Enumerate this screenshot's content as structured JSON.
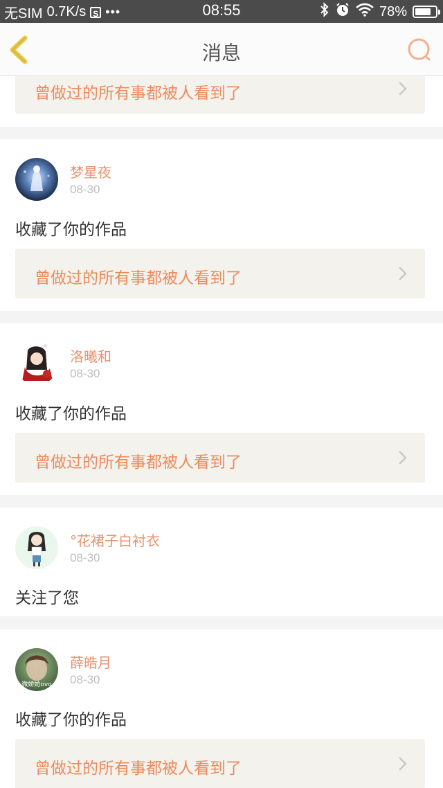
{
  "status_bar": {
    "carrier": "无SIM",
    "speed": "0.7K/s",
    "s_icon_label": "S",
    "more": "•••",
    "time": "08:55",
    "battery_text": "78%",
    "battery_level": 0.78
  },
  "header": {
    "title": "消息",
    "accent_color": "#f3b08c",
    "back_color": "#e8c94a"
  },
  "top_partial": {
    "work_title": "曾做过的所有事都被人看到了"
  },
  "notifications": [
    {
      "username": "梦星夜",
      "date": "08-30",
      "action": "收藏了你的作品",
      "work_title": "曾做过的所有事都被人看到了"
    },
    {
      "username": "洛曦和",
      "date": "08-30",
      "action": "收藏了你的作品",
      "work_title": "曾做过的所有事都被人看到了"
    },
    {
      "username": "°花裙子白衬衣",
      "date": "08-30",
      "action": "关注了您"
    },
    {
      "username": "薛皓月",
      "date": "08-30",
      "action": "收藏了你的作品",
      "work_title": "曾做过的所有事都被人看到了",
      "avatar_watermark": "微娇妨ovo"
    }
  ]
}
